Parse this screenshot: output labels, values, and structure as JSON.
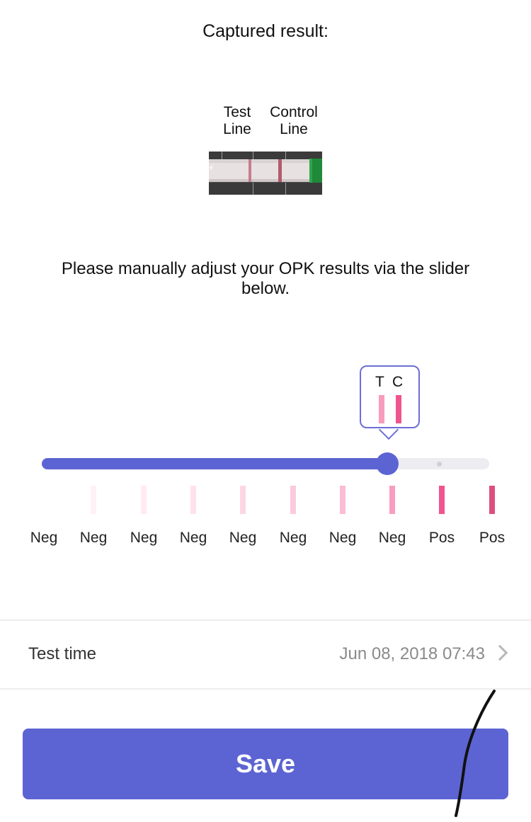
{
  "header": {
    "captured_result_label": "Captured result:"
  },
  "strip": {
    "test_line_label": "Test\nLine",
    "control_line_label": "Control\nLine"
  },
  "instructions": "Please manually adjust your OPK results via the slider below.",
  "tooltip": {
    "t_label": "T",
    "c_label": "C",
    "t_color": "#f79cbd",
    "c_color": "#f0548f"
  },
  "slider": {
    "value_fraction": 0.775,
    "fill_color": "#5c64d3",
    "track_color": "#ececf1"
  },
  "scale": {
    "labels": [
      "Neg",
      "Neg",
      "Neg",
      "Neg",
      "Neg",
      "Neg",
      "Neg",
      "Neg",
      "Pos",
      "Pos"
    ],
    "bar_colors": [
      "#ffffff",
      "#fff1f5",
      "#ffebf1",
      "#ffe2ec",
      "#fdd6e4",
      "#fccade",
      "#fbbcd4",
      "#f99dbf",
      "#f0548f",
      "#dd4f7e"
    ]
  },
  "test_time": {
    "label": "Test time",
    "value": "Jun 08, 2018 07:43"
  },
  "save_button": {
    "label": "Save"
  },
  "colors": {
    "accent": "#5c64d3"
  }
}
